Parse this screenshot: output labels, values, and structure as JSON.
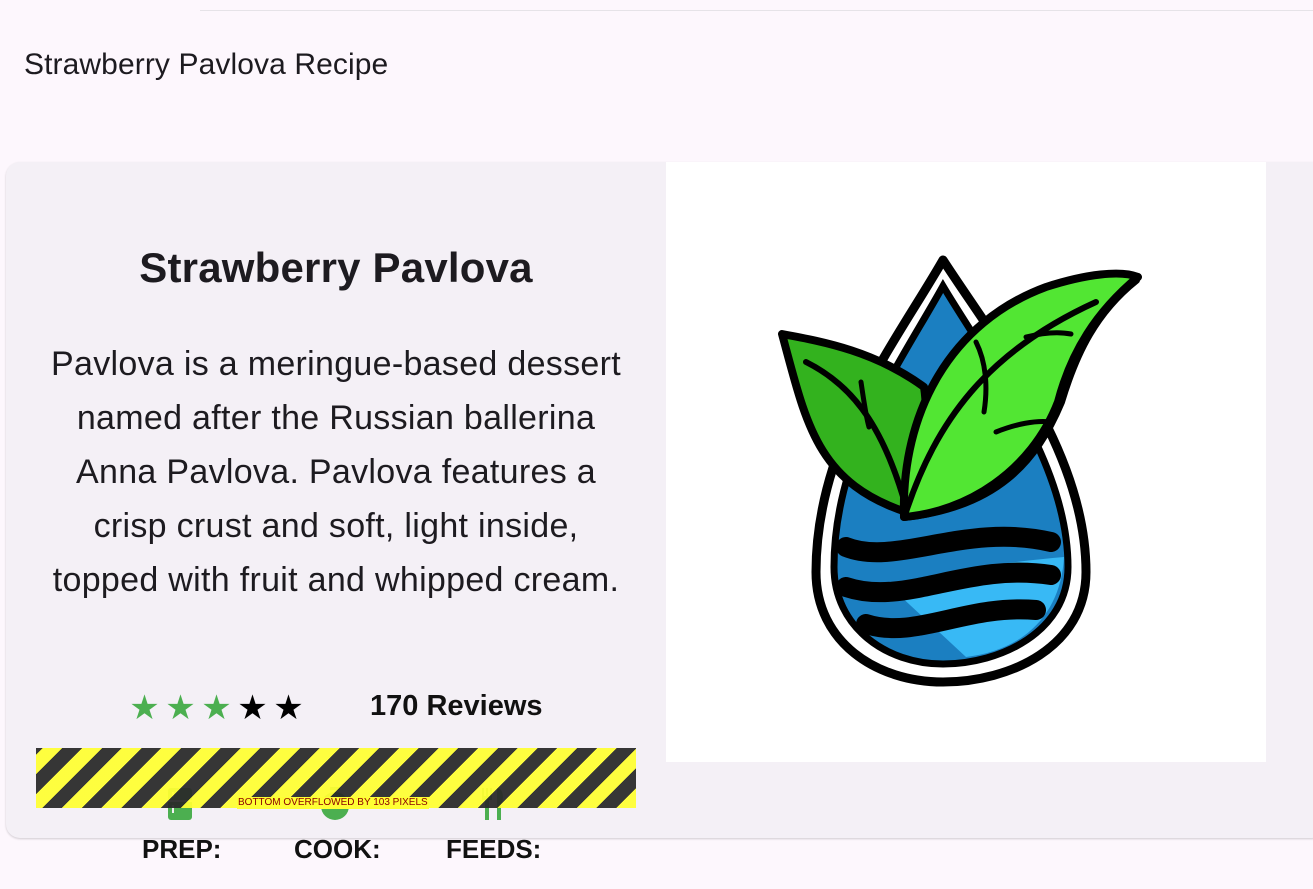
{
  "app_bar": {
    "title": "Strawberry Pavlova Recipe"
  },
  "recipe": {
    "title": "Strawberry Pavlova",
    "description": "Pavlova is a meringue-based dessert named after the Russian ballerina Anna Pavlova. Pavlova features a crisp crust and soft, light inside, topped with fruit and whipped cream.",
    "rating": {
      "filled": 3,
      "total": 5,
      "filled_color": "#4caf50",
      "empty_color": "#000000"
    },
    "reviews_label": "170 Reviews",
    "info": [
      {
        "icon": "kitchen-icon",
        "label": "PREP:"
      },
      {
        "icon": "timer-icon",
        "label": "COOK:"
      },
      {
        "icon": "restaurant-icon",
        "label": "FEEDS:"
      }
    ],
    "icon_color": "#4caf50"
  },
  "debug": {
    "overflow_text": "BOTTOM OVERFLOWED BY 103 PIXELS"
  },
  "image": {
    "icon": "leaf-water-drop-logo"
  }
}
